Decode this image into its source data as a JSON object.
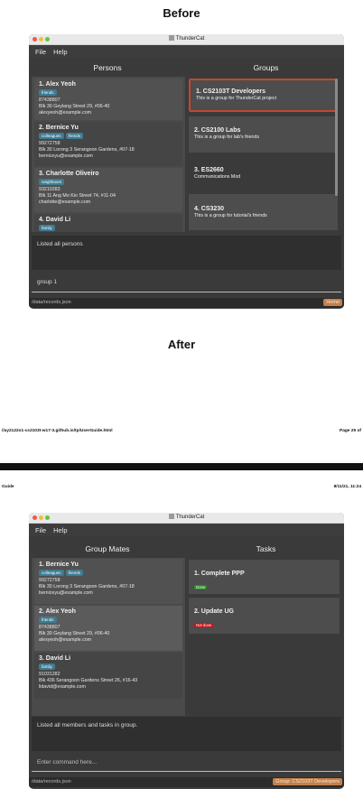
{
  "before_heading": "Before",
  "after_heading": "After",
  "pdf": {
    "url": "//ay2122s1-cs2103t-w17-3.github.io/tp/UserGuide.html",
    "page": "Page 25 of",
    "left_label": "Guide",
    "date": "8/11/21, 11:24"
  },
  "before": {
    "window_title": "ThunderCat",
    "menu": [
      "File",
      "Help"
    ],
    "left_header": "Persons",
    "right_header": "Groups",
    "persons": [
      {
        "name": "1.  Alex Yeoh",
        "tags": [
          "friends"
        ],
        "phone": "87438807",
        "address": "Blk 30 Geylang Street 29, #06-40",
        "email": "alexyeoh@example.com"
      },
      {
        "name": "2.  Bernice Yu",
        "tags": [
          "colleagues",
          "friends"
        ],
        "phone": "99272758",
        "address": "Blk 30 Lorong 3 Serangoon Gardens, #07-18",
        "email": "berniceyu@example.com"
      },
      {
        "name": "3.  Charlotte Oliveiro",
        "tags": [
          "neighbours"
        ],
        "phone": "93210283",
        "address": "Blk 11 Ang Mo Kio Street 74, #11-04",
        "email": "charlotte@example.com"
      },
      {
        "name": "4.  David Li",
        "tags": [
          "family"
        ]
      }
    ],
    "groups": [
      {
        "name": "1.  CS2103T Developers",
        "desc": "This is a group for ThunderCat project"
      },
      {
        "name": "2.  CS2100 Labs",
        "desc": "This is a group for lab's friends"
      },
      {
        "name": "3.  ES2660",
        "desc": "Communications Mod"
      },
      {
        "name": "4.  CS3230",
        "desc": "This is a group for  tutorial's friends"
      }
    ],
    "result": "Listed all persons",
    "command": "group 1",
    "path": "/data/records.json",
    "badge": "Home"
  },
  "after": {
    "window_title": "ThunderCat",
    "menu": [
      "File",
      "Help"
    ],
    "left_header": "Group Mates",
    "right_header": "Tasks",
    "mates": [
      {
        "name": "1.  Bernice Yu",
        "tags": [
          "colleagues",
          "friends"
        ],
        "phone": "99272758",
        "address": "Blk 30 Lorong 3 Serangoon Gardens, #07-18",
        "email": "berniceyu@example.com"
      },
      {
        "name": "2.  Alex Yeoh",
        "tags": [
          "friends"
        ],
        "phone": "87438807",
        "address": "Blk 30 Geylang Street 29, #06-40",
        "email": "alexyeoh@example.com"
      },
      {
        "name": "3.  David Li",
        "tags": [
          "family"
        ],
        "phone": "91031282",
        "address": "Blk 436 Serangoon Gardens Street 26, #16-43",
        "email": "lidavid@example.com"
      }
    ],
    "tasks": [
      {
        "name": "1.  Complete PPP",
        "status": "Done"
      },
      {
        "name": "2.  Update UG",
        "status": "Not done"
      }
    ],
    "result": "Listed all members and tasks in group.",
    "placeholder": "Enter command here...",
    "path": "/data/records.json",
    "badge": "Group: CS2103T Developers"
  },
  "colors": {
    "selected_border": "#c4472e",
    "tag_blue": "#3e7b91",
    "done_green": "#2a8a2a",
    "not_done_red": "#c0141a",
    "badge_orange": "#c1804f"
  }
}
